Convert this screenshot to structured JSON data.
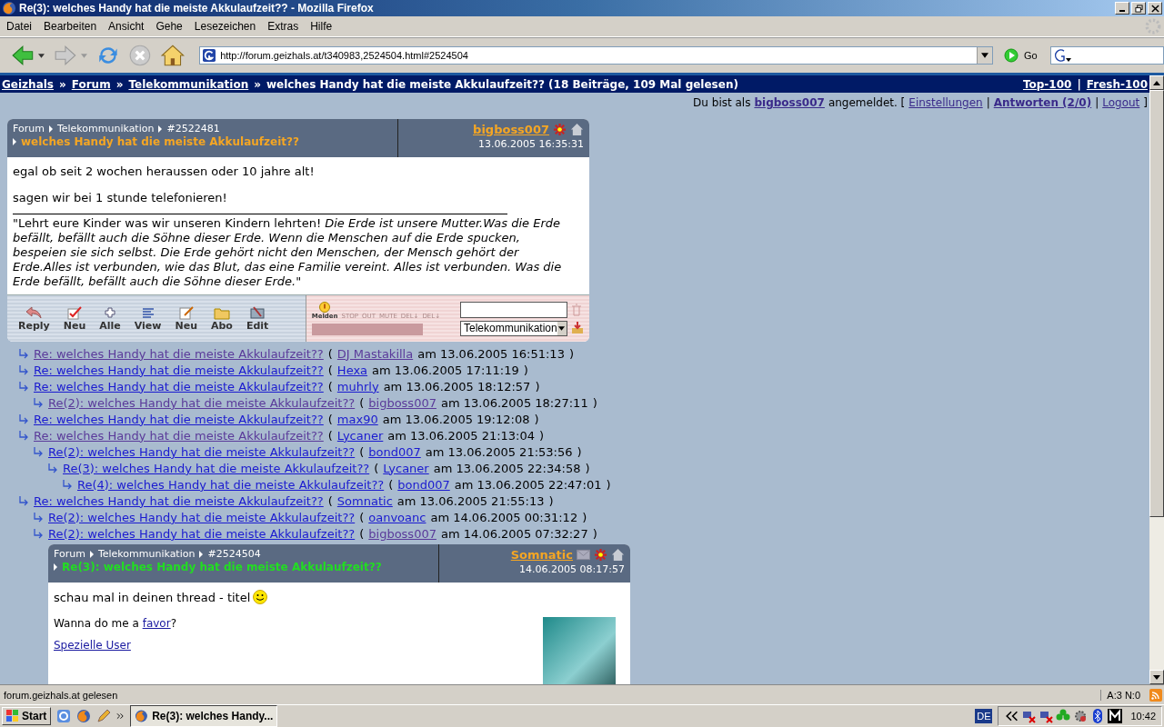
{
  "window": {
    "title": "Re(3): welches Handy hat die meiste Akkulaufzeit?? - Mozilla Firefox"
  },
  "menu": [
    "Datei",
    "Bearbeiten",
    "Ansicht",
    "Gehe",
    "Lesezeichen",
    "Extras",
    "Hilfe"
  ],
  "toolbar": {
    "url": "http://forum.geizhals.at/t340983,2524504.html#2524504",
    "go": "Go"
  },
  "nav_bar": {
    "items": [
      {
        "kind": "link",
        "label": "Geizhals"
      },
      {
        "kind": "sep",
        "label": "»"
      },
      {
        "kind": "link",
        "label": "Forum"
      },
      {
        "kind": "sep",
        "label": "»"
      },
      {
        "kind": "link",
        "label": "Telekommunikation"
      },
      {
        "kind": "sep",
        "label": "»"
      },
      {
        "kind": "text",
        "label": "welches Handy hat die meiste Akkulaufzeit?? (18 Beiträge, 109 Mal gelesen)"
      }
    ],
    "right": [
      {
        "kind": "link",
        "label": "Top-100"
      },
      {
        "kind": "sep",
        "label": "|"
      },
      {
        "kind": "link",
        "label": "Fresh-100"
      }
    ]
  },
  "login_bar": [
    {
      "kind": "text",
      "label": "Du bist als"
    },
    {
      "kind": "user",
      "label": "bigboss007"
    },
    {
      "kind": "text",
      "label": "angemeldet. ["
    },
    {
      "kind": "link",
      "label": "Einstellungen"
    },
    {
      "kind": "text",
      "label": "|"
    },
    {
      "kind": "bold_link",
      "label": "Antworten (2/0)"
    },
    {
      "kind": "text",
      "label": "|"
    },
    {
      "kind": "link",
      "label": "Logout"
    },
    {
      "kind": "text",
      "label": "]"
    }
  ],
  "first_post": {
    "crumbs": [
      "Forum",
      "Telekommunikation",
      "#2522481"
    ],
    "title": "welches Handy hat die meiste Akkulaufzeit??",
    "current": false,
    "author": "bigboss007",
    "date": "13.06.2005 16:35:31",
    "paragraphs": [
      "egal ob seit 2 wochen heraussen oder 10 jahre alt!",
      "sagen wir bei 1 stunde telefonieren!"
    ],
    "signature": "\"Lehrt eure Kinder was wir unseren Kindern lehrten! *Die Erde ist unsere Mutter.Was die Erde befällt, befällt auch die Söhne dieser Erde. Wenn die Menschen auf die Erde spucken, bespeien sie sich selbst. Die Erde gehört nicht den Menschen, der Mensch gehört der Erde.Alles ist verbunden, wie das Blut, das eine Familie vereint. Alles ist verbunden. Was die Erde befällt, befällt auch die Söhne dieser Erde.\"*",
    "actions": [
      {
        "kind": "reply",
        "label": "Reply"
      },
      {
        "kind": "check",
        "label": "Neu"
      },
      {
        "kind": "plus",
        "label": "Alle"
      },
      {
        "kind": "lines",
        "label": "View"
      },
      {
        "kind": "write",
        "label": "Neu"
      },
      {
        "kind": "folder",
        "label": "Abo"
      },
      {
        "kind": "edit",
        "label": "Edit"
      }
    ],
    "mod_tools": [
      "Melden",
      "STOP",
      "OUT",
      "MUTE",
      "DEL↓",
      "DEL↓"
    ],
    "forum_select": "Telekommunikation"
  },
  "thread": [
    {
      "title": "Re: welches Handy hat die meiste Akkulaufzeit??",
      "author": "DJ Mastakilla",
      "date": "am 13.06.2005 16:51:13",
      "visited": true,
      "author_visited": true
    },
    {
      "title": "Re: welches Handy hat die meiste Akkulaufzeit??",
      "author": "Hexa",
      "date": "am 13.06.2005 17:11:19",
      "visited": false,
      "author_visited": false
    },
    {
      "title": "Re: welches Handy hat die meiste Akkulaufzeit??",
      "author": "muhrly",
      "date": "am 13.06.2005 18:12:57",
      "visited": false,
      "author_visited": false,
      "children": [
        {
          "title": "Re(2): welches Handy hat die meiste Akkulaufzeit??",
          "author": "bigboss007",
          "date": "am 13.06.2005 18:27:11",
          "visited": true,
          "author_visited": true
        }
      ]
    },
    {
      "title": "Re: welches Handy hat die meiste Akkulaufzeit??",
      "author": "max90",
      "date": "am 13.06.2005 19:12:08",
      "visited": false,
      "author_visited": false
    },
    {
      "title": "Re: welches Handy hat die meiste Akkulaufzeit??",
      "author": "Lycaner",
      "date": "am 13.06.2005 21:13:04",
      "visited": true,
      "author_visited": false,
      "children": [
        {
          "title": "Re(2): welches Handy hat die meiste Akkulaufzeit??",
          "author": "bond007",
          "date": "am 13.06.2005 21:53:56",
          "visited": false,
          "author_visited": false,
          "children": [
            {
              "title": "Re(3): welches Handy hat die meiste Akkulaufzeit??",
              "author": "Lycaner",
              "date": "am 13.06.2005 22:34:58",
              "visited": false,
              "author_visited": false,
              "children": [
                {
                  "title": "Re(4): welches Handy hat die meiste Akkulaufzeit??",
                  "author": "bond007",
                  "date": "am 13.06.2005 22:47:01",
                  "visited": false,
                  "author_visited": false
                }
              ]
            }
          ]
        }
      ]
    },
    {
      "title": "Re: welches Handy hat die meiste Akkulaufzeit??",
      "author": "Somnatic",
      "date": "am 13.06.2005 21:55:13",
      "visited": false,
      "author_visited": false,
      "children": [
        {
          "title": "Re(2): welches Handy hat die meiste Akkulaufzeit??",
          "author": "oanvoanc",
          "date": "am 14.06.2005 00:31:12",
          "visited": false,
          "author_visited": false
        },
        {
          "title": "Re(2): welches Handy hat die meiste Akkulaufzeit??",
          "author": "bigboss007",
          "date": "am 14.06.2005 07:32:27",
          "visited": false,
          "author_visited": true
        }
      ]
    }
  ],
  "thread_brackets": [
    "(",
    ")"
  ],
  "current_post": {
    "crumbs": [
      "Forum",
      "Telekommunikation",
      "#2524504"
    ],
    "title": "Re(3): welches Handy hat die meiste Akkulaufzeit??",
    "current": true,
    "author": "Somnatic",
    "date": "14.06.2005 08:17:57",
    "mail": true,
    "paragraphs": [
      "schau mal in deinen thread - titel"
    ],
    "smiley": true,
    "signature_parts": [
      {
        "kind": "text",
        "label": "Wanna do me a "
      },
      {
        "kind": "link",
        "label": "favor"
      },
      {
        "kind": "text",
        "label": "?"
      }
    ],
    "signature_links": [
      "Spezielle User"
    ],
    "photo": true
  },
  "status_bar": {
    "text": "forum.geizhals.at gelesen",
    "counter": "A:3 N:0"
  },
  "taskbar": {
    "start": "Start",
    "task": "Re(3): welches Handy...",
    "language": "DE",
    "clock": "10:42"
  }
}
